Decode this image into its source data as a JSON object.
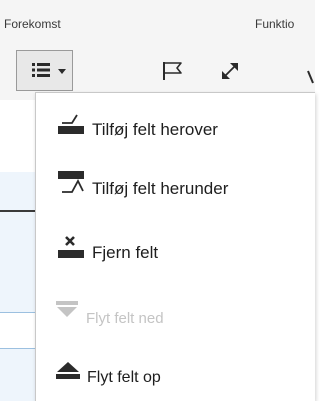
{
  "ribbon": {
    "groups": [
      "Forekomst",
      "Funktio"
    ]
  },
  "icons": {
    "list_button": "bulleted-list-icon",
    "list_dropdown": "dropdown-arrow-icon",
    "flag": "flag-icon",
    "expand": "expand-arrows-icon"
  },
  "menu": {
    "items": [
      {
        "label": "Tilføj felt herover",
        "icon": "insert-field-above-icon",
        "enabled": true
      },
      {
        "label": "Tilføj felt herunder",
        "icon": "insert-field-below-icon",
        "enabled": true
      },
      {
        "label": "Fjern felt",
        "icon": "remove-field-icon",
        "enabled": true
      },
      {
        "label": "Flyt felt ned",
        "icon": "move-down-icon",
        "enabled": false
      },
      {
        "label": "Flyt felt op",
        "icon": "move-up-icon",
        "enabled": true
      }
    ]
  },
  "colors": {
    "ribbon_bg": "#f5f5f5",
    "button_bg": "#e8e8e8",
    "accent_line": "#9cc0e0",
    "icon": "#2b2b2b",
    "disabled": "#c4c4c4"
  }
}
